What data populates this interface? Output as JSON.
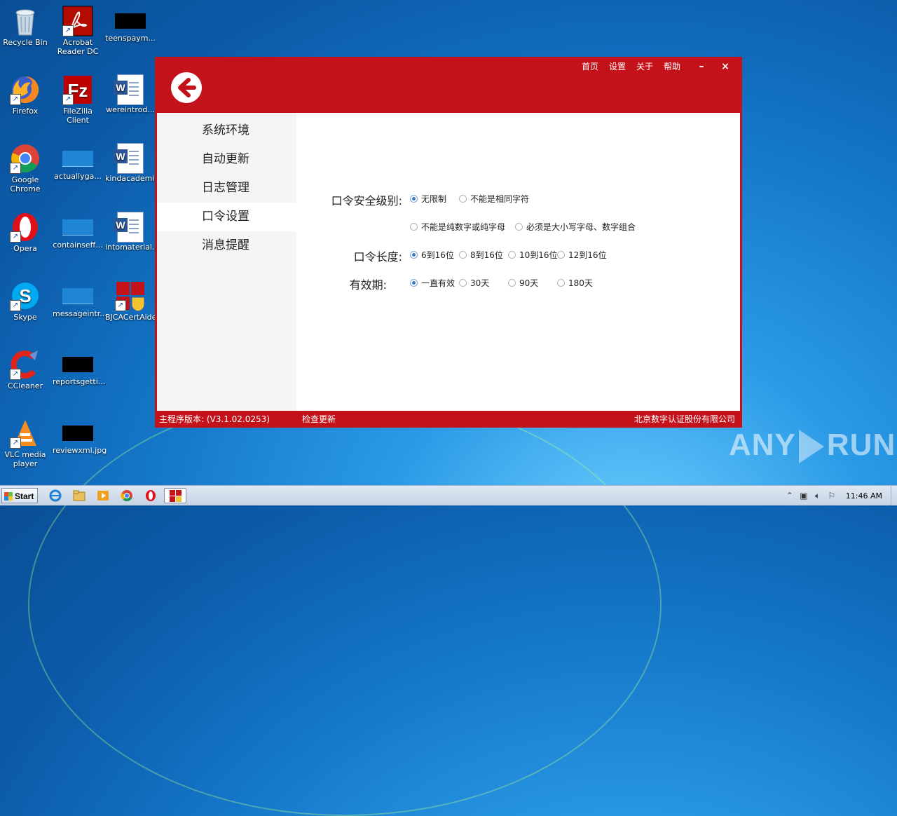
{
  "desktop": {
    "icons": [
      {
        "label": "Recycle Bin",
        "icon": "recycle-bin-icon"
      },
      {
        "label": "Acrobat Reader DC",
        "icon": "acrobat-icon"
      },
      {
        "label": "teenspaym...",
        "icon": "file-thumb-icon"
      },
      {
        "label": "Firefox",
        "icon": "firefox-icon"
      },
      {
        "label": "FileZilla Client",
        "icon": "filezilla-icon"
      },
      {
        "label": "wereintrod...",
        "icon": "word-doc-icon"
      },
      {
        "label": "Google Chrome",
        "icon": "chrome-icon"
      },
      {
        "label": "actuallyga...",
        "icon": "file-thumb-icon"
      },
      {
        "label": "kindacademi...",
        "icon": "word-doc-icon"
      },
      {
        "label": "Opera",
        "icon": "opera-icon"
      },
      {
        "label": "containseff...",
        "icon": "file-thumb-icon"
      },
      {
        "label": "intomaterial...",
        "icon": "word-doc-icon"
      },
      {
        "label": "Skype",
        "icon": "skype-icon"
      },
      {
        "label": "messageintr...",
        "icon": "file-thumb-icon"
      },
      {
        "label": "BJCACertAide",
        "icon": "app-shield-icon"
      },
      {
        "label": "CCleaner",
        "icon": "ccleaner-icon"
      },
      {
        "label": "reportsgetti...",
        "icon": "file-thumb-icon"
      },
      {
        "label": "VLC media player",
        "icon": "vlc-icon"
      },
      {
        "label": "reviewxml.jpg",
        "icon": "file-thumb-icon"
      }
    ]
  },
  "app": {
    "top_menu": [
      "首页",
      "设置",
      "关于",
      "帮助"
    ],
    "minimize": "–",
    "close": "×",
    "sidebar": [
      {
        "label": "系统环境",
        "active": false
      },
      {
        "label": "自动更新",
        "active": false
      },
      {
        "label": "日志管理",
        "active": false
      },
      {
        "label": "口令设置",
        "active": true
      },
      {
        "label": "消息提醒",
        "active": false
      }
    ],
    "settings": {
      "security_level": {
        "label": "口令安全级别:",
        "options": [
          "无限制",
          "不能是相同字符",
          "不能是纯数字或纯字母",
          "必须是大小写字母、数字组合"
        ],
        "selected": 0
      },
      "length": {
        "label": "口令长度:",
        "options": [
          "6到16位",
          "8到16位",
          "10到16位",
          "12到16位"
        ],
        "selected": 0
      },
      "validity": {
        "label": "有效期:",
        "options": [
          "一直有效",
          "30天",
          "90天",
          "180天"
        ],
        "selected": 0
      }
    },
    "footer": {
      "version": "主程序版本: (V3.1.02.0253)",
      "check_update": "检查更新",
      "company": "北京数字认证股份有限公司"
    },
    "colors": {
      "brand_red": "#c4121a",
      "radio_selected": "#3c7fc8"
    }
  },
  "watermark": {
    "left": "ANY",
    "right": "RUN"
  },
  "taskbar": {
    "start_label": "Start",
    "clock": "11:46 AM"
  }
}
